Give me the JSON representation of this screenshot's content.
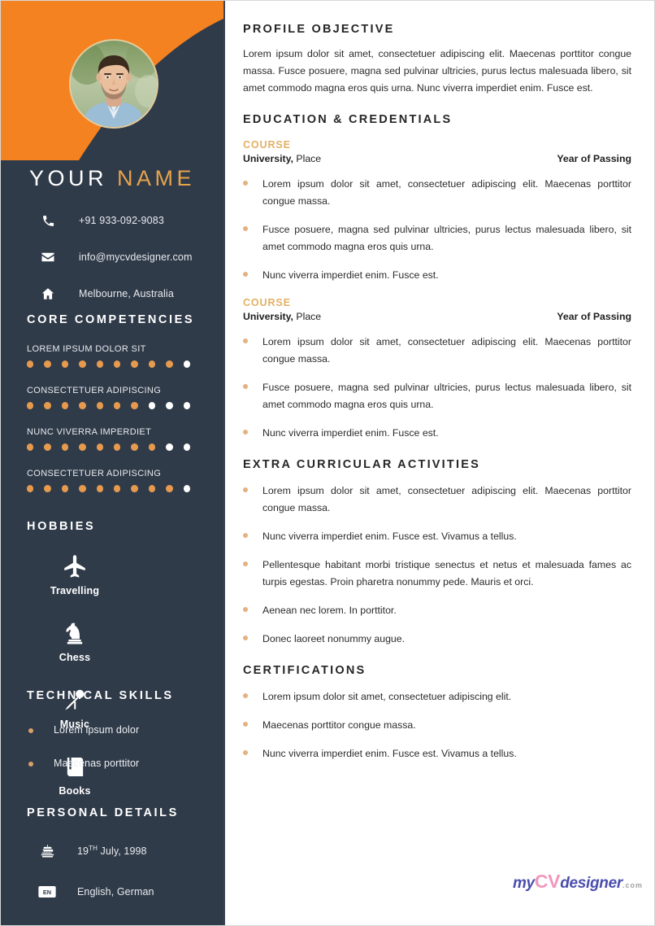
{
  "colors": {
    "orange": "#f58220",
    "navy": "#303b4a",
    "accent_gold": "#e3b063",
    "dot_on": "#e69a4e",
    "dot_off": "#ffffff",
    "bullet": "#e5b181"
  },
  "sidebar": {
    "name_first": "YOUR",
    "name_last": "NAME",
    "photo_alt": "profile-photo",
    "contacts": [
      {
        "icon": "phone-icon",
        "value": "+91 933-092-9083"
      },
      {
        "icon": "envelope-icon",
        "value": "info@mycvdesigner.com"
      },
      {
        "icon": "home-icon",
        "value": "Melbourne, Australia"
      }
    ],
    "competencies_heading": "CORE COMPETENCIES",
    "competencies": [
      {
        "label": "LOREM IPSUM DOLOR SIT",
        "filled": 9,
        "total": 10
      },
      {
        "label": "CONSECTETUER ADIPISCING",
        "filled": 7,
        "total": 10
      },
      {
        "label": "NUNC VIVERRA IMPERDIET",
        "filled": 8,
        "total": 10
      },
      {
        "label": "CONSECTETUER ADIPISCING",
        "filled": 9,
        "total": 10
      }
    ],
    "hobbies_heading": "HOBBIES",
    "hobbies": [
      {
        "icon": "airplane-icon",
        "label": "Travelling"
      },
      {
        "icon": "chess-knight-icon",
        "label": "Chess"
      },
      {
        "icon": "microphone-icon",
        "label": "Music"
      },
      {
        "icon": "book-icon",
        "label": "Books"
      }
    ],
    "technical_heading": "TECHNICAL SKILLS",
    "technical_skills": [
      "Lorem ipsum dolor",
      "Maecenas porttitor"
    ],
    "personal_heading": "PERSONAL DETAILS",
    "personal_details": [
      {
        "icon": "birthday-cake-icon",
        "day": "19",
        "ordinal": "TH",
        "rest": " July, 1998"
      },
      {
        "icon": "language-en-badge-icon",
        "badge": "EN",
        "rest": "English, German"
      }
    ]
  },
  "main": {
    "profile_heading": "PROFILE OBJECTIVE",
    "profile_text": "Lorem ipsum dolor sit amet, consectetuer adipiscing elit. Maecenas porttitor congue massa. Fusce posuere, magna sed pulvinar ultricies, purus lectus malesuada libero, sit amet commodo magna eros quis urna. Nunc viverra imperdiet enim. Fusce est.",
    "education_heading": "EDUCATION & CREDENTIALS",
    "education": [
      {
        "course_tag": "COURSE",
        "university": "University,",
        "place": " Place",
        "year": "Year of Passing",
        "bullets": [
          "Lorem ipsum dolor sit amet, consectetuer adipiscing elit. Maecenas porttitor congue massa.",
          "Fusce posuere, magna sed pulvinar ultricies, purus lectus malesuada libero, sit amet commodo magna eros quis urna.",
          "Nunc viverra imperdiet enim. Fusce est."
        ]
      },
      {
        "course_tag": "COURSE",
        "university": "University,",
        "place": " Place",
        "year": "Year of Passing",
        "bullets": [
          "Lorem ipsum dolor sit amet, consectetuer adipiscing elit. Maecenas porttitor congue massa.",
          "Fusce posuere, magna sed pulvinar ultricies, purus lectus malesuada libero, sit amet commodo magna eros quis urna.",
          "Nunc viverra imperdiet enim. Fusce est."
        ]
      }
    ],
    "extra_heading": "EXTRA CURRICULAR ACTIVITIES",
    "extra_bullets": [
      "Lorem ipsum dolor sit amet, consectetuer adipiscing elit. Maecenas porttitor congue massa.",
      "Nunc viverra imperdiet enim. Fusce est. Vivamus a tellus.",
      "Pellentesque habitant morbi tristique senectus et netus et malesuada fames ac turpis egestas. Proin pharetra nonummy pede. Mauris et orci.",
      "Aenean nec lorem. In porttitor.",
      "Donec laoreet nonummy augue."
    ],
    "certifications_heading": "CERTIFICATIONS",
    "certification_bullets": [
      "Lorem ipsum dolor sit amet, consectetuer adipiscing elit.",
      "Maecenas porttitor congue massa.",
      "Nunc viverra imperdiet enim. Fusce est. Vivamus a tellus."
    ]
  },
  "watermark": {
    "my": "my",
    "cv": "CV",
    "designer": "designer",
    "com": ".com"
  }
}
